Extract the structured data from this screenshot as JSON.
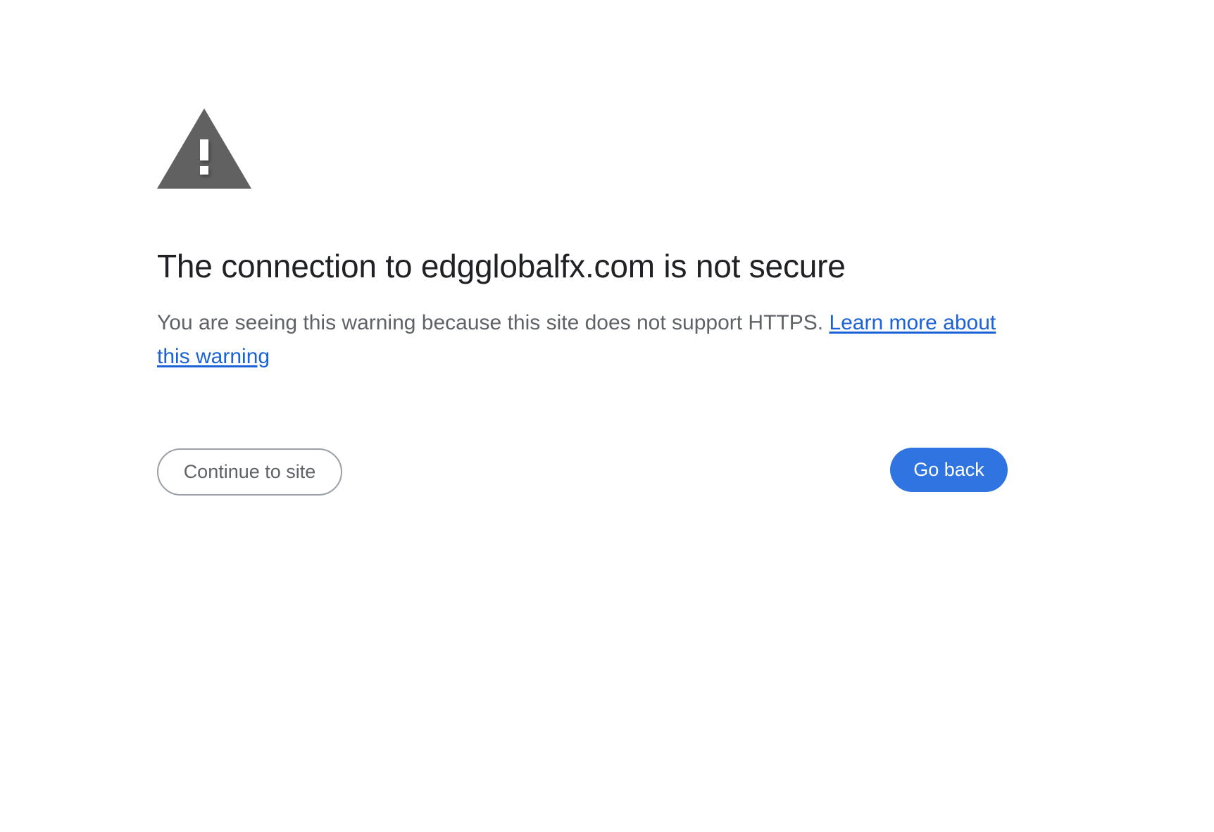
{
  "icon": {
    "name": "warning-triangle-icon",
    "color": "#616161"
  },
  "title": "The connection to edgglobalfx.com is not secure",
  "explanation": {
    "text": "You are seeing this warning because this site does not support HTTPS. ",
    "link_text": "Learn more about this warning",
    "link_color": "#1a62d6"
  },
  "buttons": {
    "continue_label": "Continue to site",
    "back_label": "Go back",
    "back_color": "#2f74e0"
  }
}
